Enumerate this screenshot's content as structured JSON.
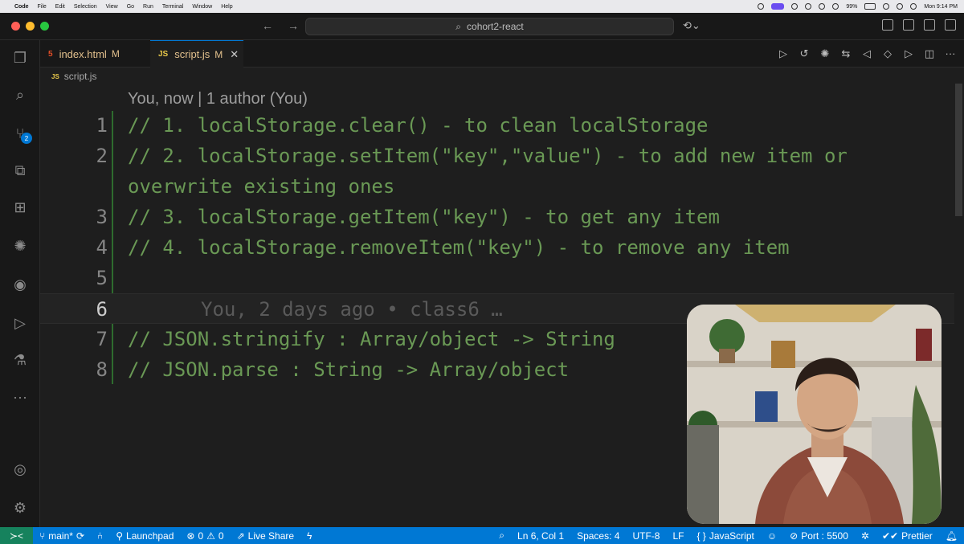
{
  "menubar": {
    "app_name": "Code",
    "items": [
      "File",
      "Edit",
      "Selection",
      "View",
      "Go",
      "Run",
      "Terminal",
      "Window",
      "Help"
    ],
    "battery": "99%",
    "clock": "Mon 9:14 PM"
  },
  "titlebar": {
    "search_text": "cohort2-react"
  },
  "activity": {
    "scm_badge": "2"
  },
  "tabs": [
    {
      "icon": "5",
      "label": "index.html",
      "status": "M"
    },
    {
      "icon": "JS",
      "label": "script.js",
      "status": "M",
      "close": "✕"
    }
  ],
  "breadcrumb": {
    "icon": "JS",
    "file": "script.js"
  },
  "editor": {
    "codelens": "You, now | 1 author (You)",
    "lines": [
      {
        "num": "1",
        "text": "// 1. localStorage.clear() - to clean localStorage"
      },
      {
        "num": "2",
        "text": "// 2. localStorage.setItem(\"key\",\"value\") - to add new item or"
      },
      {
        "num": "",
        "text": "overwrite existing ones"
      },
      {
        "num": "3",
        "text": "// 3. localStorage.getItem(\"key\") - to get any item"
      },
      {
        "num": "4",
        "text": "// 4. localStorage.removeItem(\"key\") - to remove any item"
      },
      {
        "num": "5",
        "text": ""
      },
      {
        "num": "6",
        "text": ""
      },
      {
        "num": "7",
        "text": "// JSON.stringify : Array/object -> String"
      },
      {
        "num": "8",
        "text": "// JSON.parse : String -> Array/object"
      }
    ],
    "blame": "You, 2 days ago • class6 …"
  },
  "statusbar": {
    "branch": "main*",
    "launchpad": "Launchpad",
    "errors": "0",
    "warnings": "0",
    "liveshare": "Live Share",
    "cursor": "Ln 6, Col 1",
    "spaces": "Spaces: 4",
    "encoding": "UTF-8",
    "eol": "LF",
    "language": "JavaScript",
    "port": "Port : 5500",
    "prettier": "Prettier"
  }
}
